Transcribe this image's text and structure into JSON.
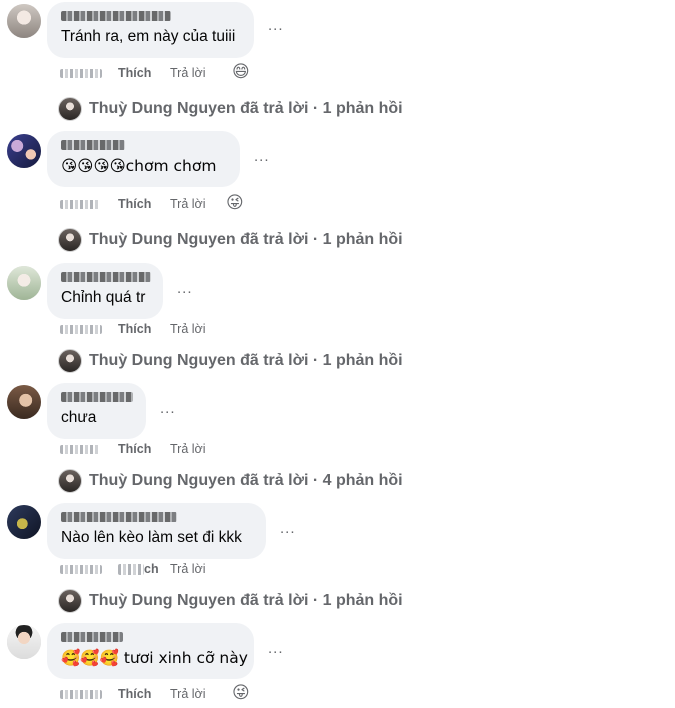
{
  "comments": [
    {
      "text": "Tránh ra, em này của tuiii",
      "more": "...",
      "like": "Thích",
      "reply": "Trả lời",
      "reaction": "😄",
      "reply_summary": "Thuỳ Dung Nguyen đã trả lời · 1 phản hồi",
      "avatar_color": "#d9d4cf"
    },
    {
      "text": "😘😘😘😘chơm chơm",
      "more": "...",
      "like": "Thích",
      "reply": "Trả lời",
      "reaction": "😜",
      "reply_summary": "Thuỳ Dung Nguyen đã trả lời · 1 phản hồi",
      "avatar_color": "#3b3f8f"
    },
    {
      "text": "Chỉnh quá tr",
      "more": "...",
      "like": "Thích",
      "reply": "Trả lời",
      "reaction": "",
      "reply_summary": "Thuỳ Dung Nguyen đã trả lời · 1 phản hồi",
      "avatar_color": "#c9d6c4"
    },
    {
      "text": "chưa",
      "more": "...",
      "like": "Thích",
      "reply": "Trả lời",
      "reaction": "",
      "reply_summary": "Thuỳ Dung Nguyen đã trả lời · 4 phản hồi",
      "avatar_color": "#7a5a45"
    },
    {
      "text": "Nào lên kèo làm set đi kkk",
      "more": "...",
      "like": "ch",
      "reply": "Trả lời",
      "reaction": "",
      "reply_summary": "Thuỳ Dung Nguyen đã trả lời · 1 phản hồi",
      "avatar_color": "#2d3a5c"
    },
    {
      "text": "🥰🥰🥰 tươi xinh cỡ này",
      "more": "...",
      "like": "Thích",
      "reply": "Trả lời",
      "reaction": "😜",
      "reply_summary": "",
      "avatar_color": "#f1f1f1"
    }
  ]
}
